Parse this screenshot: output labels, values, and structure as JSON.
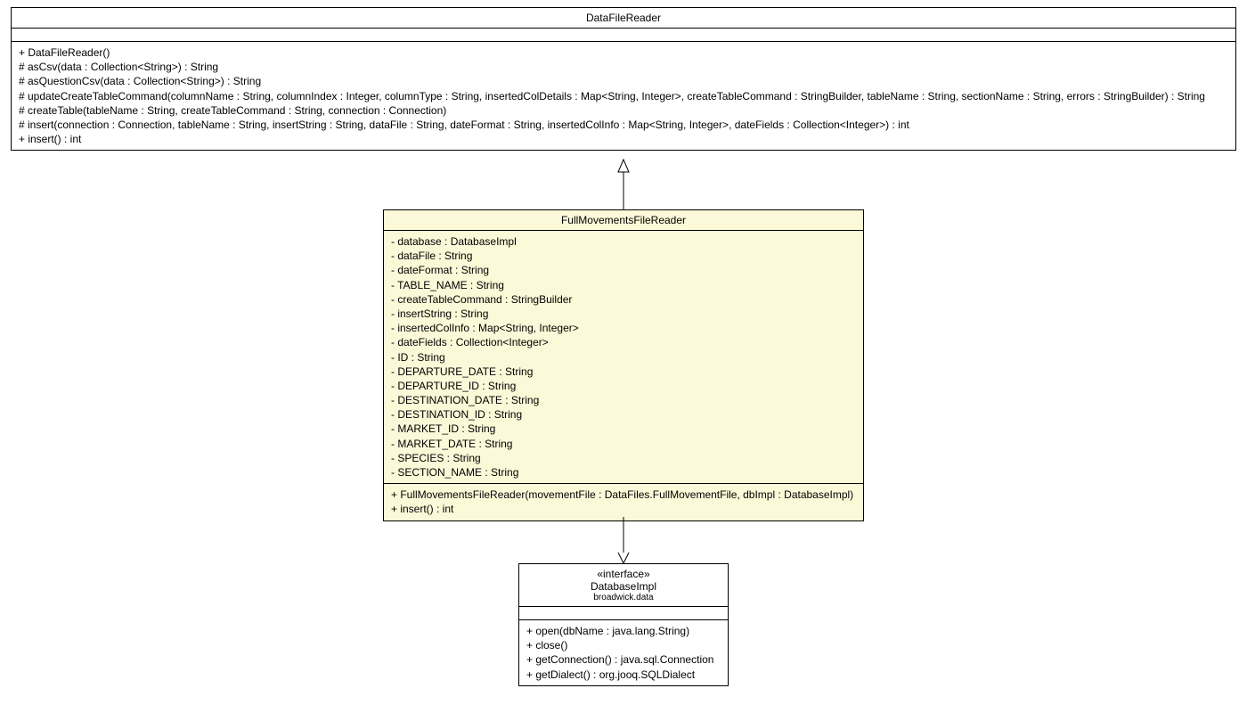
{
  "classes": {
    "dataFileReader": {
      "name": "DataFileReader",
      "methods": [
        "+ DataFileReader()",
        "# asCsv(data : Collection<String>) : String",
        "# asQuestionCsv(data : Collection<String>) : String",
        "# updateCreateTableCommand(columnName : String, columnIndex : Integer, columnType : String, insertedColDetails : Map<String, Integer>, createTableCommand : StringBuilder, tableName : String, sectionName : String, errors : StringBuilder) : String",
        "# createTable(tableName : String, createTableCommand : String, connection : Connection)",
        "# insert(connection : Connection, tableName : String, insertString : String, dataFile : String, dateFormat : String, insertedColInfo : Map<String, Integer>, dateFields : Collection<Integer>) : int",
        "+ insert() : int"
      ]
    },
    "fullMovementsFileReader": {
      "name": "FullMovementsFileReader",
      "attributes": [
        "- database : DatabaseImpl",
        "- dataFile : String",
        "- dateFormat : String",
        "- TABLE_NAME : String",
        "- createTableCommand : StringBuilder",
        "- insertString : String",
        "- insertedColInfo : Map<String, Integer>",
        "- dateFields : Collection<Integer>",
        "- ID : String",
        "- DEPARTURE_DATE : String",
        "- DEPARTURE_ID : String",
        "- DESTINATION_DATE : String",
        "- DESTINATION_ID : String",
        "- MARKET_ID : String",
        "- MARKET_DATE : String",
        "- SPECIES : String",
        "- SECTION_NAME : String"
      ],
      "methods": [
        "+ FullMovementsFileReader(movementFile : DataFiles.FullMovementFile, dbImpl : DatabaseImpl)",
        "+ insert() : int"
      ]
    },
    "databaseImpl": {
      "stereotype": "«interface»",
      "name": "DatabaseImpl",
      "package": "broadwick.data",
      "methods": [
        "+ open(dbName : java.lang.String)",
        "+ close()",
        "+ getConnection() : java.sql.Connection",
        "+ getDialect() : org.jooq.SQLDialect"
      ]
    }
  }
}
